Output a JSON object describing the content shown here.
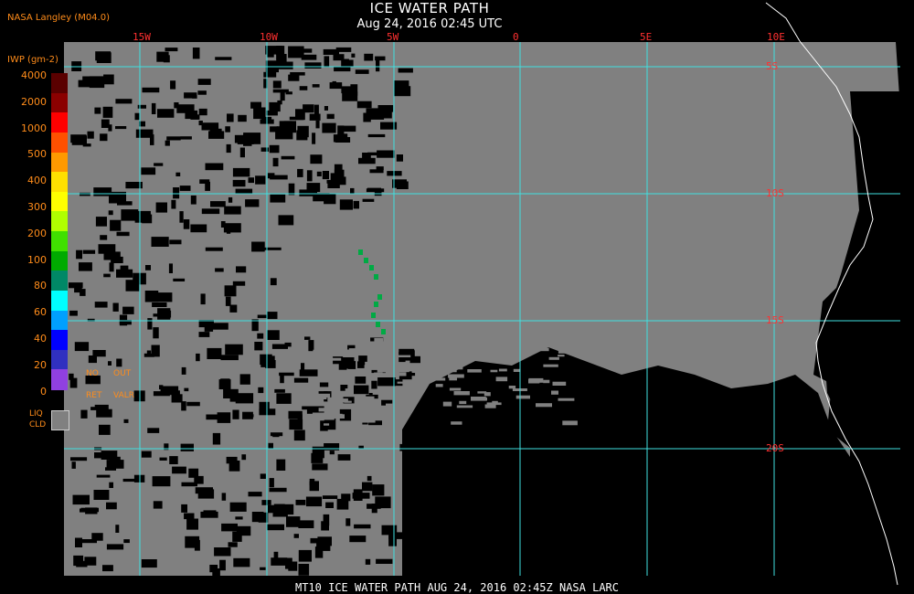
{
  "producer": "NASA Langley (M04.0)",
  "title": "ICE WATER PATH",
  "subtitle": "Aug 24, 2016 02:45 UTC",
  "legend": {
    "title": "IWP (gm-2)",
    "ticks": [
      "4000",
      "2000",
      "1000",
      "500",
      "400",
      "300",
      "200",
      "100",
      "80",
      "60",
      "40",
      "20",
      "0"
    ],
    "colors": [
      "#5a0000",
      "#8b0000",
      "#ff0000",
      "#ff5000",
      "#ff9900",
      "#ffe000",
      "#ffff00",
      "#b0ff00",
      "#40e000",
      "#00aa00",
      "#008866",
      "#00ffff",
      "#00a0ff",
      "#0000ff",
      "#3030c0",
      "#9040e0"
    ],
    "no_retrieval": [
      "NO",
      "RET"
    ],
    "out_valid": [
      "OUT",
      "VALR"
    ],
    "liq_cld": [
      "LIQ",
      "CLD"
    ],
    "liq_color": "#808080"
  },
  "grid": {
    "lon_labels": [
      "15W",
      "10W",
      "5W",
      "0",
      "5E",
      "10E"
    ],
    "lat_labels": [
      "5S",
      "10S",
      "15S",
      "20S"
    ],
    "line_color": "#40e0e0"
  },
  "colors": {
    "cloud": "#808080",
    "clear": "#000000",
    "ice": "#00aa44",
    "coast": "#ffffff"
  },
  "footer": "MT10  ICE WATER PATH   AUG 24, 2016 02:45Z   NASA LARC"
}
